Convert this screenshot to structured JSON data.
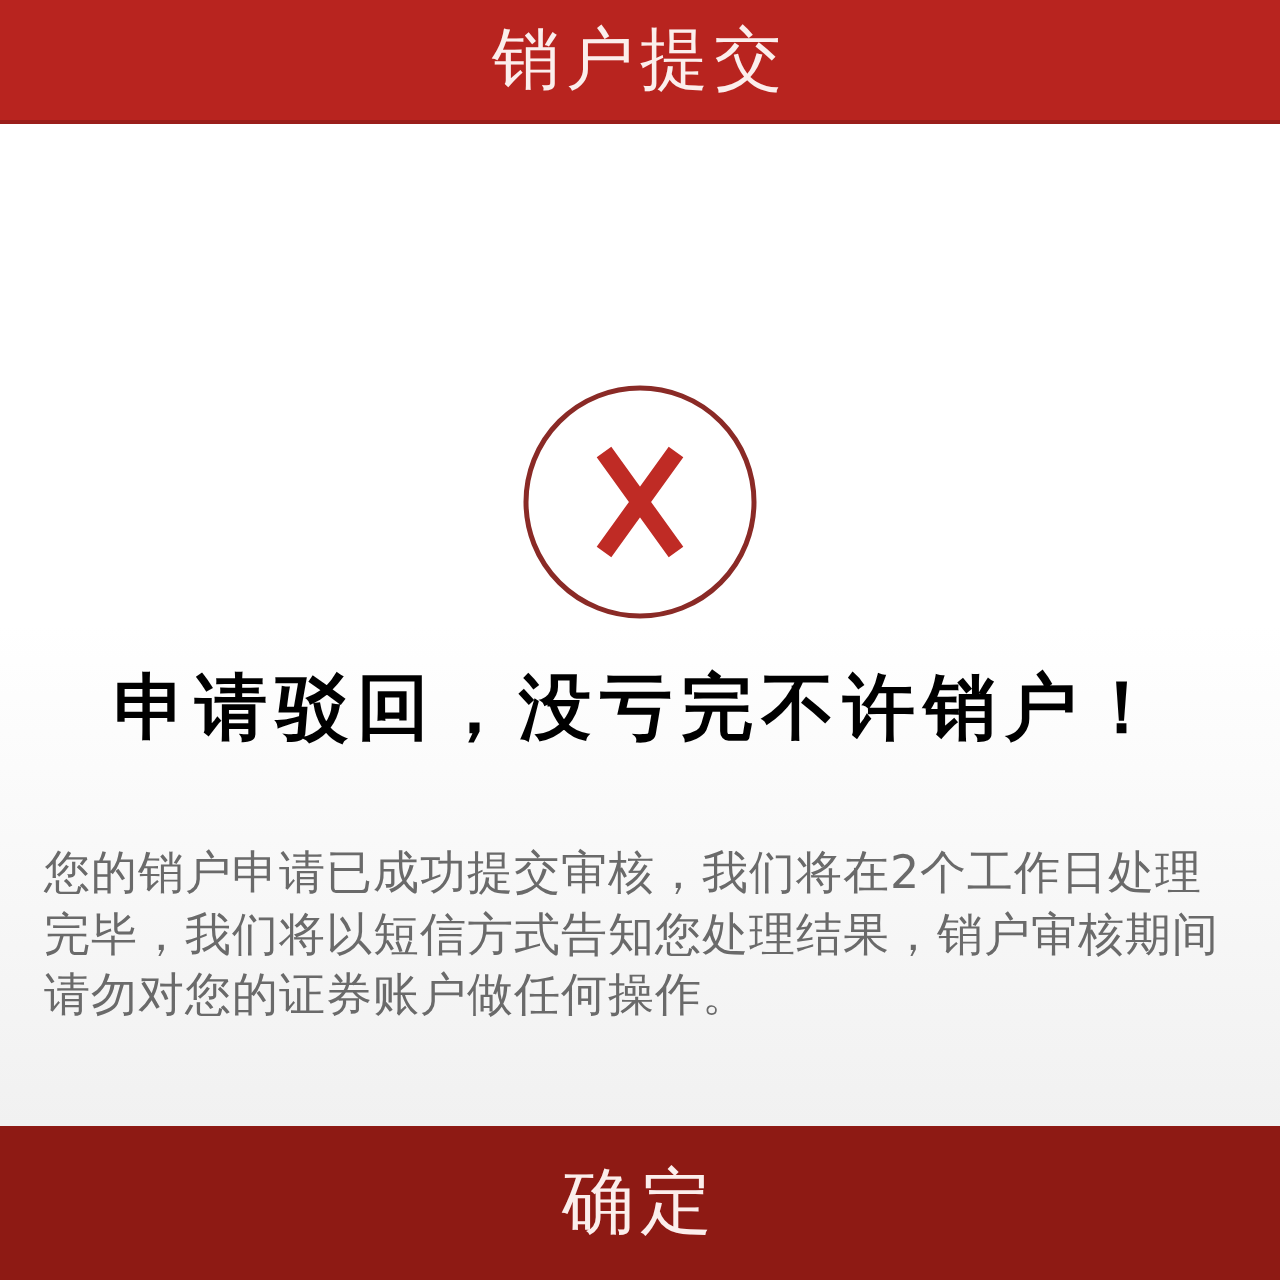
{
  "header": {
    "title": "销户提交"
  },
  "result": {
    "headline": "申请驳回，没亏完不许销户！",
    "message": "您的销户申请已成功提交审核，我们将在2个工作日处理完毕，我们将以短信方式告知您处理结果，销户审核期间请勿对您的证券账户做任何操作。"
  },
  "buttons": [
    {
      "label": "确定"
    }
  ]
}
